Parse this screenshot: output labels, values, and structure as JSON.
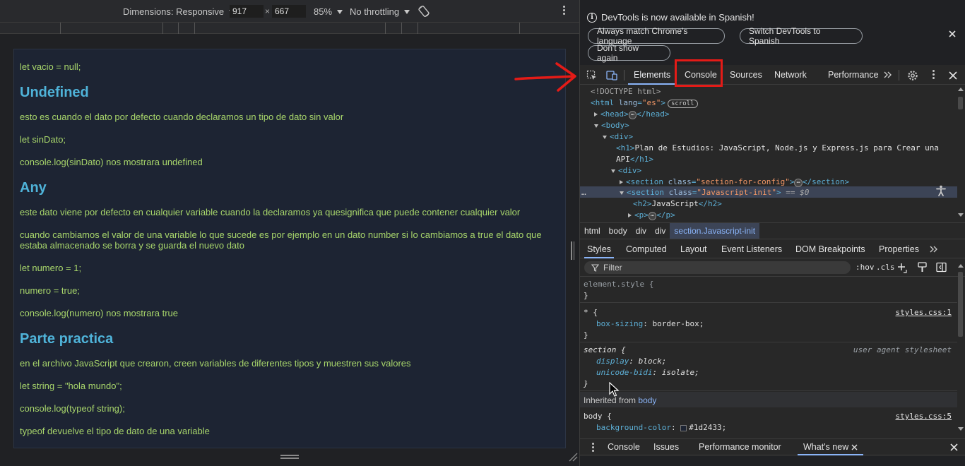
{
  "device_toolbar": {
    "dimensions_label": "Dimensions: Responsive",
    "width_value": "917",
    "height_value": "667",
    "times": "×",
    "zoom": "85%",
    "throttling": "No throttling"
  },
  "page": {
    "blocks": [
      {
        "type": "p",
        "text": "let vacio = null;"
      },
      {
        "type": "h2",
        "text": "Undefined"
      },
      {
        "type": "p",
        "text": "esto es cuando el dato por defecto cuando declaramos un tipo de dato sin valor"
      },
      {
        "type": "p",
        "text": "let sinDato;"
      },
      {
        "type": "p",
        "text": "console.log(sinDato) nos mostrara undefined"
      },
      {
        "type": "h2",
        "text": "Any"
      },
      {
        "type": "p",
        "text": "este dato viene por defecto en cualquier variable cuando la declaramos ya quesignifica que puede contener cualquier valor"
      },
      {
        "type": "p",
        "text": "cuando cambiamos el valor de una variable lo que sucede es por ejemplo en un dato number si lo cambiamos a true el dato que estaba almacenado se borra y se guarda el nuevo dato"
      },
      {
        "type": "p",
        "text": "let numero = 1;"
      },
      {
        "type": "p",
        "text": "numero = true;"
      },
      {
        "type": "p",
        "text": "console.log(numero) nos mostrara true"
      },
      {
        "type": "h2",
        "text": "Parte practica"
      },
      {
        "type": "p",
        "text": "en el archivo JavaScript que crearon, creen variables de diferentes tipos y muestren sus valores"
      },
      {
        "type": "p",
        "text": "let string = \"hola mundo\";"
      },
      {
        "type": "p",
        "text": "console.log(typeof string);"
      },
      {
        "type": "p",
        "text": "typeof devuelve el tipo de dato de una variable"
      }
    ]
  },
  "devtools": {
    "infobar": {
      "message": "DevTools is now available in Spanish!",
      "btn_match": "Always match Chrome's language",
      "btn_switch": "Switch DevTools to Spanish",
      "btn_dont_show": "Don't show again"
    },
    "tabs": [
      "Elements",
      "Console",
      "Sources",
      "Network",
      "Performance"
    ],
    "dom": {
      "doctype": "<!DOCTYPE html>",
      "html_tag": "html",
      "lang_attr": "lang",
      "lang_val": "\"es\"",
      "scroll_badge": "scroll",
      "head_open": "<head>",
      "head_close": "</head>",
      "body_open": "<body>",
      "div_open": "<div>",
      "h1_open": "<h1>",
      "h1_text": "Plan de Estudios: JavaScript, Node.js y Express.js para Crear una",
      "h1_text2": "API",
      "h1_close": "</h1>",
      "div2_open": "<div>",
      "section_tag": "<section",
      "class_attr": "class",
      "section1_class": "\"section-for-config\"",
      "section1_close": "</section>",
      "section2_class": "\"Javascript-init\"",
      "section2_suffix": "== $0",
      "h2_open": "<h2>",
      "h2_text": "JavaScript",
      "h2_close": "</h2>",
      "p_open": "<p>",
      "p_close": "</p>",
      "dots": "⋯"
    },
    "breadcrumbs": [
      "html",
      "body",
      "div",
      "div",
      "section.Javascript-init"
    ],
    "subtabs": [
      "Styles",
      "Computed",
      "Layout",
      "Event Listeners",
      "DOM Breakpoints",
      "Properties"
    ],
    "filter": {
      "placeholder": "Filter",
      "hov": ":hov",
      "cls": ".cls"
    },
    "styles": {
      "element_style": "element.style {",
      "close_brace": "}",
      "star_selector": "* {",
      "star_source": "styles.css:1",
      "box_sizing_prop": "box-sizing",
      "box_sizing_val": "border-box;",
      "section_selector": "section {",
      "ua_label": "user agent stylesheet",
      "display_prop": "display",
      "display_val": "block;",
      "unicode_prop": "unicode-bidi",
      "unicode_val": "isolate;",
      "inherited_label": "Inherited from",
      "inherited_from": "body",
      "body_selector": "body {",
      "body_source": "styles.css:5",
      "bg_prop": "background-color",
      "bg_val": "#1d2433;",
      "bg_swatch": "#1d2433"
    },
    "drawer_tabs": [
      "Console",
      "Issues",
      "Performance monitor",
      "What's new"
    ]
  }
}
